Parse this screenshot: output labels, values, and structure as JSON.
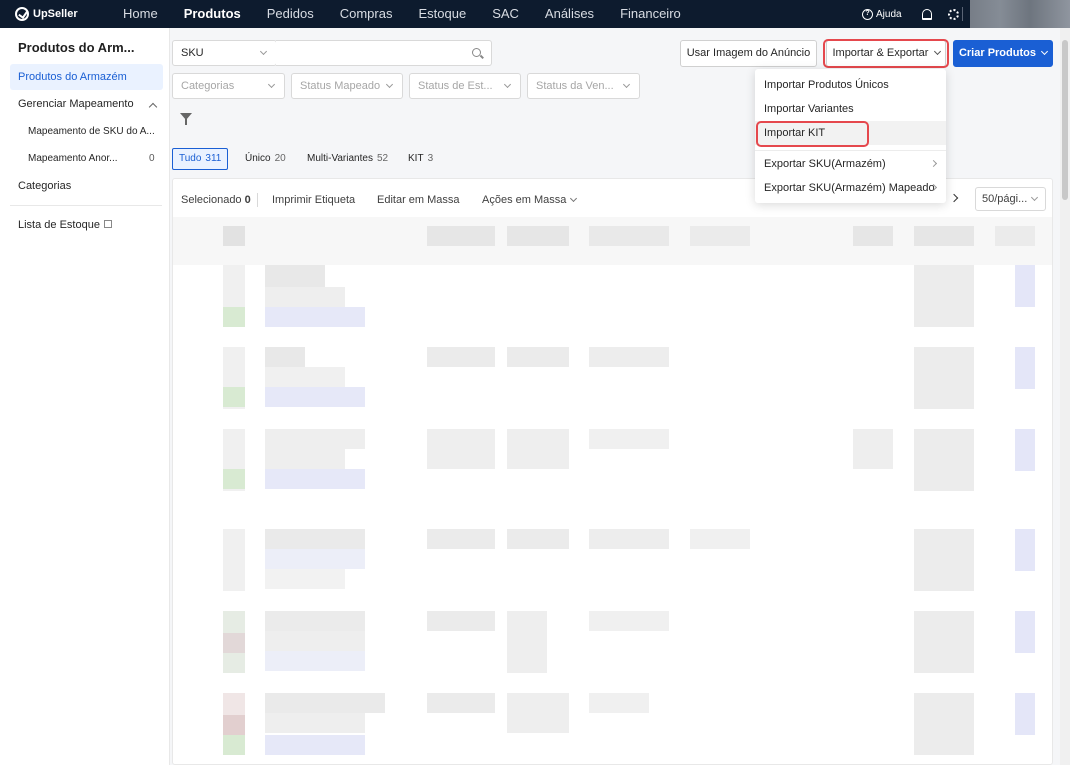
{
  "app": {
    "brand": "UpSeller"
  },
  "topnav": {
    "items": [
      "Home",
      "Produtos",
      "Pedidos",
      "Compras",
      "Estoque",
      "SAC",
      "Análises",
      "Financeiro"
    ],
    "active": "Produtos",
    "help_label": "Ajuda",
    "help_glyph": "?"
  },
  "sidebar": {
    "title": "Produtos do Arm...",
    "active_item": "Produtos do Armazém",
    "group_label": "Gerenciar Mapeamento",
    "sub_items": [
      {
        "label": "Mapeamento de SKU do A...",
        "count": ""
      },
      {
        "label": "Mapeamento Anor...",
        "count": "0"
      }
    ],
    "categories_label": "Categorias",
    "stock_list_label": "Lista de Estoque"
  },
  "filters": {
    "search_type": "SKU",
    "search_placeholder": "",
    "selects": [
      "Categorias",
      "Status Mapeado",
      "Status de Est...",
      "Status da Ven..."
    ]
  },
  "actions": {
    "use_image": "Usar Imagem do Anúncio",
    "import_export": "Importar & Exportar",
    "create_products": "Criar Produtos"
  },
  "tabs": [
    {
      "label": "Tudo",
      "count": "311"
    },
    {
      "label": "Único",
      "count": "20"
    },
    {
      "label": "Multi-Variantes",
      "count": "52"
    },
    {
      "label": "KIT",
      "count": "3"
    }
  ],
  "table_toolbar": {
    "selected_label": "Selecionado",
    "selected_count": "0",
    "print_label": "Imprimir Etiqueta",
    "bulk_edit": "Editar em Massa",
    "bulk_actions": "Ações em Massa",
    "page_size": "50/pági..."
  },
  "dropdown": {
    "items": [
      {
        "label": "Importar Produtos Únicos",
        "has_submenu": false
      },
      {
        "label": "Importar Variantes",
        "has_submenu": false
      },
      {
        "label": "Importar KIT",
        "has_submenu": false
      },
      {
        "label": "Exportar SKU(Armazém)",
        "has_submenu": true
      },
      {
        "label": "Exportar SKU(Armazém) Mapeado",
        "has_submenu": true
      }
    ],
    "highlighted": "Importar KIT"
  },
  "colors": {
    "primary": "#1a5fd4",
    "nav_bg": "#0d1b2e",
    "highlight": "#e5484d"
  }
}
